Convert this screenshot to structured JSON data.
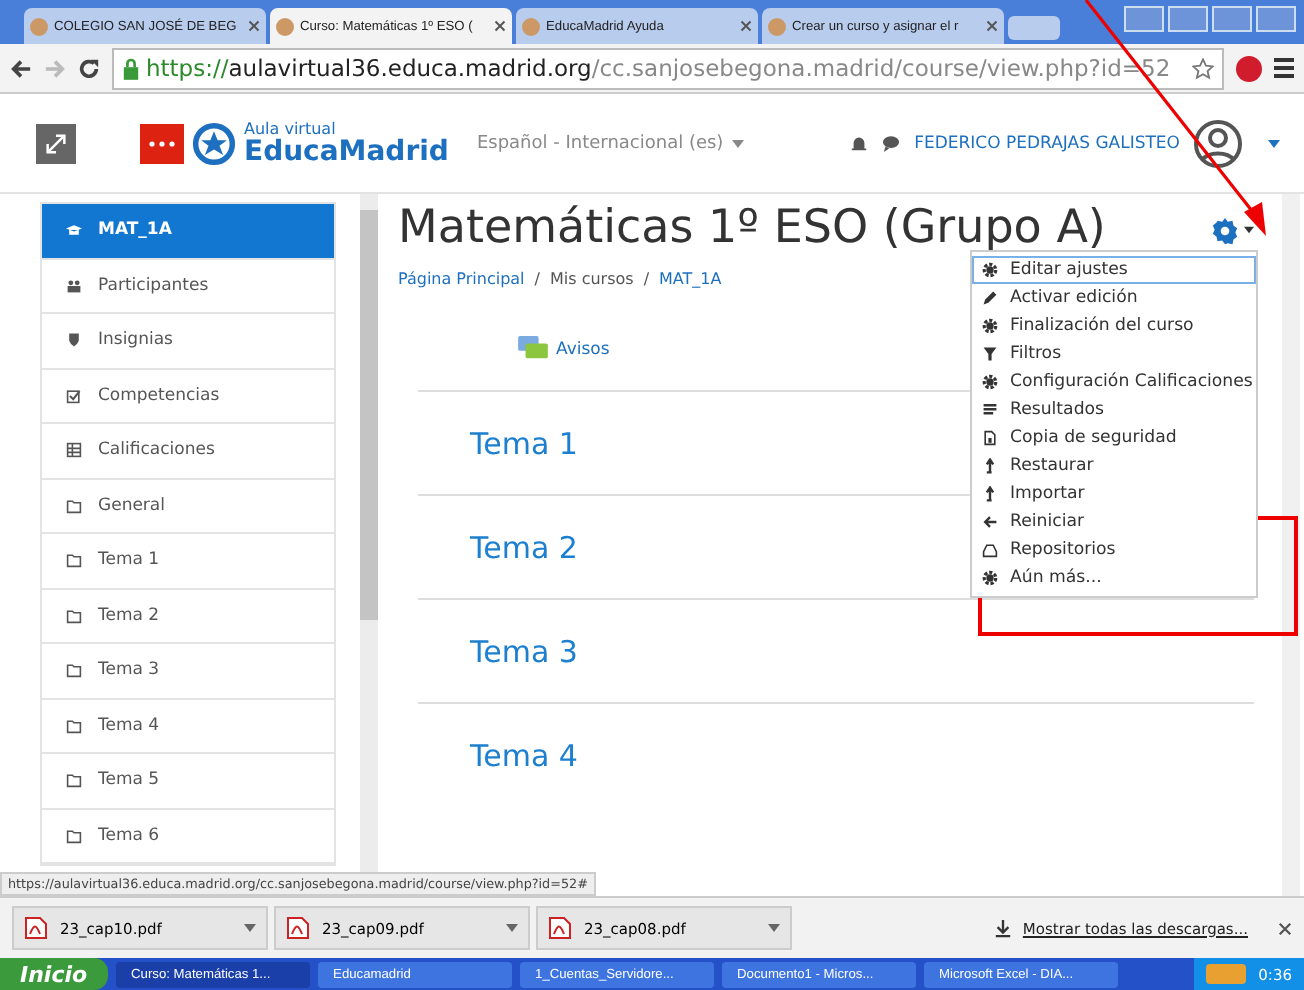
{
  "browser_tabs": [
    {
      "label": "COLEGIO SAN JOSÉ DE BEG",
      "selected": false
    },
    {
      "label": "Curso: Matemáticas 1º ESO (",
      "selected": true
    },
    {
      "label": "EducaMadrid Ayuda",
      "selected": false
    },
    {
      "label": "Crear un curso y asignar el r",
      "selected": false
    }
  ],
  "address_bar": {
    "scheme": "https://",
    "host": "aulavirtual36.educa.madrid.org",
    "path": "/cc.sanjosebegona.madrid/course/view.php?id=52"
  },
  "header": {
    "logo_small": "Aula virtual",
    "logo_big": "EducaMadrid",
    "language": "Español - Internacional (es)",
    "user": "FEDERICO PEDRAJAS GALISTEO"
  },
  "sidebar": {
    "items": [
      {
        "label": "MAT_1A",
        "kind": "course",
        "selected": true
      },
      {
        "label": "Participantes",
        "kind": "users",
        "selected": false
      },
      {
        "label": "Insignias",
        "kind": "shield",
        "selected": false
      },
      {
        "label": "Competencias",
        "kind": "check",
        "selected": false
      },
      {
        "label": "Calificaciones",
        "kind": "table",
        "selected": false
      },
      {
        "label": "General",
        "kind": "folder",
        "selected": false
      },
      {
        "label": "Tema 1",
        "kind": "folder",
        "selected": false
      },
      {
        "label": "Tema 2",
        "kind": "folder",
        "selected": false
      },
      {
        "label": "Tema 3",
        "kind": "folder",
        "selected": false
      },
      {
        "label": "Tema 4",
        "kind": "folder",
        "selected": false
      },
      {
        "label": "Tema 5",
        "kind": "folder",
        "selected": false
      },
      {
        "label": "Tema 6",
        "kind": "folder",
        "selected": false
      }
    ]
  },
  "page": {
    "title": "Matemáticas 1º ESO (Grupo A)",
    "breadcrumb": [
      {
        "label": "Página Principal",
        "link": true
      },
      {
        "label": "Mis cursos",
        "link": false
      },
      {
        "label": "MAT_1A",
        "link": true
      }
    ],
    "breadcrumb_separator": "/",
    "forum": "Avisos",
    "sections": [
      "Tema 1",
      "Tema 2",
      "Tema 3",
      "Tema 4"
    ]
  },
  "settings_menu": {
    "items": [
      {
        "label": "Editar ajustes",
        "kind": "gear",
        "selected": true
      },
      {
        "label": "Activar edición",
        "kind": "pencil",
        "selected": false
      },
      {
        "label": "Finalización del curso",
        "kind": "gear",
        "selected": false
      },
      {
        "label": "Filtros",
        "kind": "filter",
        "selected": false
      },
      {
        "label": "Configuración Calificaciones",
        "kind": "gear",
        "selected": false
      },
      {
        "label": "Resultados",
        "kind": "list",
        "selected": false
      },
      {
        "label": "Copia de seguridad",
        "kind": "file",
        "selected": false
      },
      {
        "label": "Restaurar",
        "kind": "upload",
        "selected": false
      },
      {
        "label": "Importar",
        "kind": "upload",
        "selected": false
      },
      {
        "label": "Reiniciar",
        "kind": "back",
        "selected": false
      },
      {
        "label": "Repositorios",
        "kind": "drive",
        "selected": false
      },
      {
        "label": "Aún más...",
        "kind": "gear",
        "selected": false
      }
    ]
  },
  "status_url": "https://aulavirtual36.educa.madrid.org/cc.sanjosebegona.madrid/course/view.php?id=52#",
  "downloads": {
    "files": [
      "23_cap10.pdf",
      "23_cap09.pdf",
      "23_cap08.pdf"
    ],
    "show_all": "Mostrar todas las descargas..."
  },
  "taskbar": {
    "start": "Inicio",
    "items": [
      {
        "label": "Curso: Matemáticas 1...",
        "selected": true
      },
      {
        "label": "Educamadrid",
        "selected": false
      },
      {
        "label": "1_Cuentas_Servidore...",
        "selected": false
      },
      {
        "label": "Documento1 - Micros...",
        "selected": false
      },
      {
        "label": "Microsoft Excel - DIA...",
        "selected": false
      }
    ],
    "clock": "0:36"
  },
  "annotations": {
    "arrow": true,
    "highlight_box": true
  }
}
